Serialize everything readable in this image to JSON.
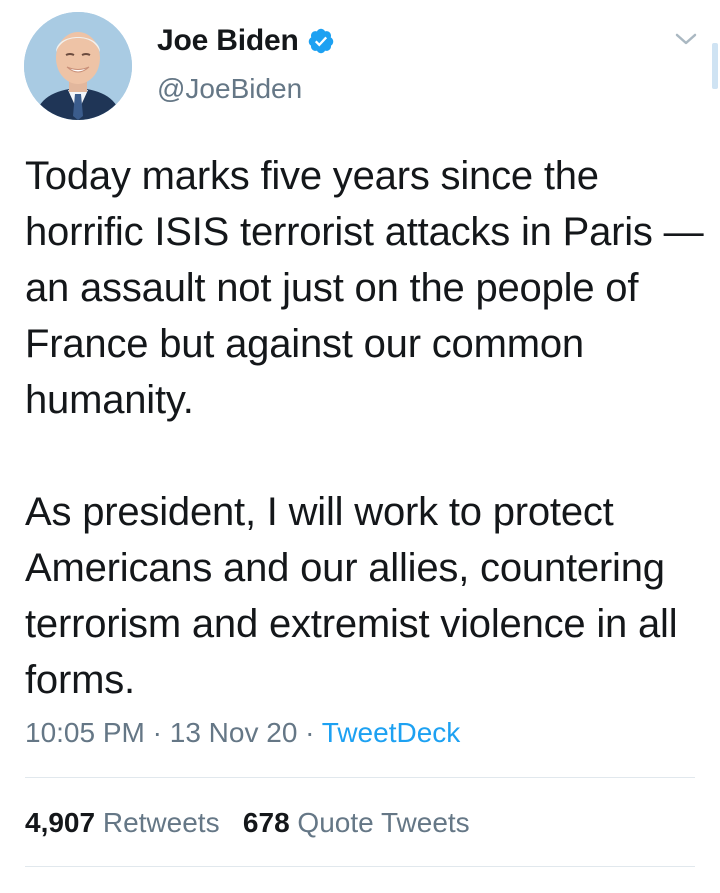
{
  "author": {
    "name": "Joe Biden",
    "handle": "@JoeBiden",
    "verified_icon": "verified-badge-icon",
    "avatar": "profile-photo"
  },
  "tweet": {
    "paragraphs": [
      "Today marks five years since the horrific ISIS terrorist attacks in Paris — an assault not just on the people of France but against our common humanity.",
      "As president, I will work to protect Americans and our allies, countering terrorism and extremist violence in all forms."
    ],
    "time": "10:05 PM",
    "date": "13 Nov 20",
    "source": "TweetDeck",
    "separator": " · "
  },
  "stats": {
    "retweets_count": "4,907",
    "retweets_label": "Retweets",
    "quotes_count": "678",
    "quotes_label": "Quote Tweets"
  },
  "colors": {
    "link": "#1da1f2",
    "secondary_text": "#657786",
    "primary_text": "#14171a",
    "divider": "#e1e8ed"
  },
  "icons": {
    "menu": "chevron-down-icon"
  }
}
